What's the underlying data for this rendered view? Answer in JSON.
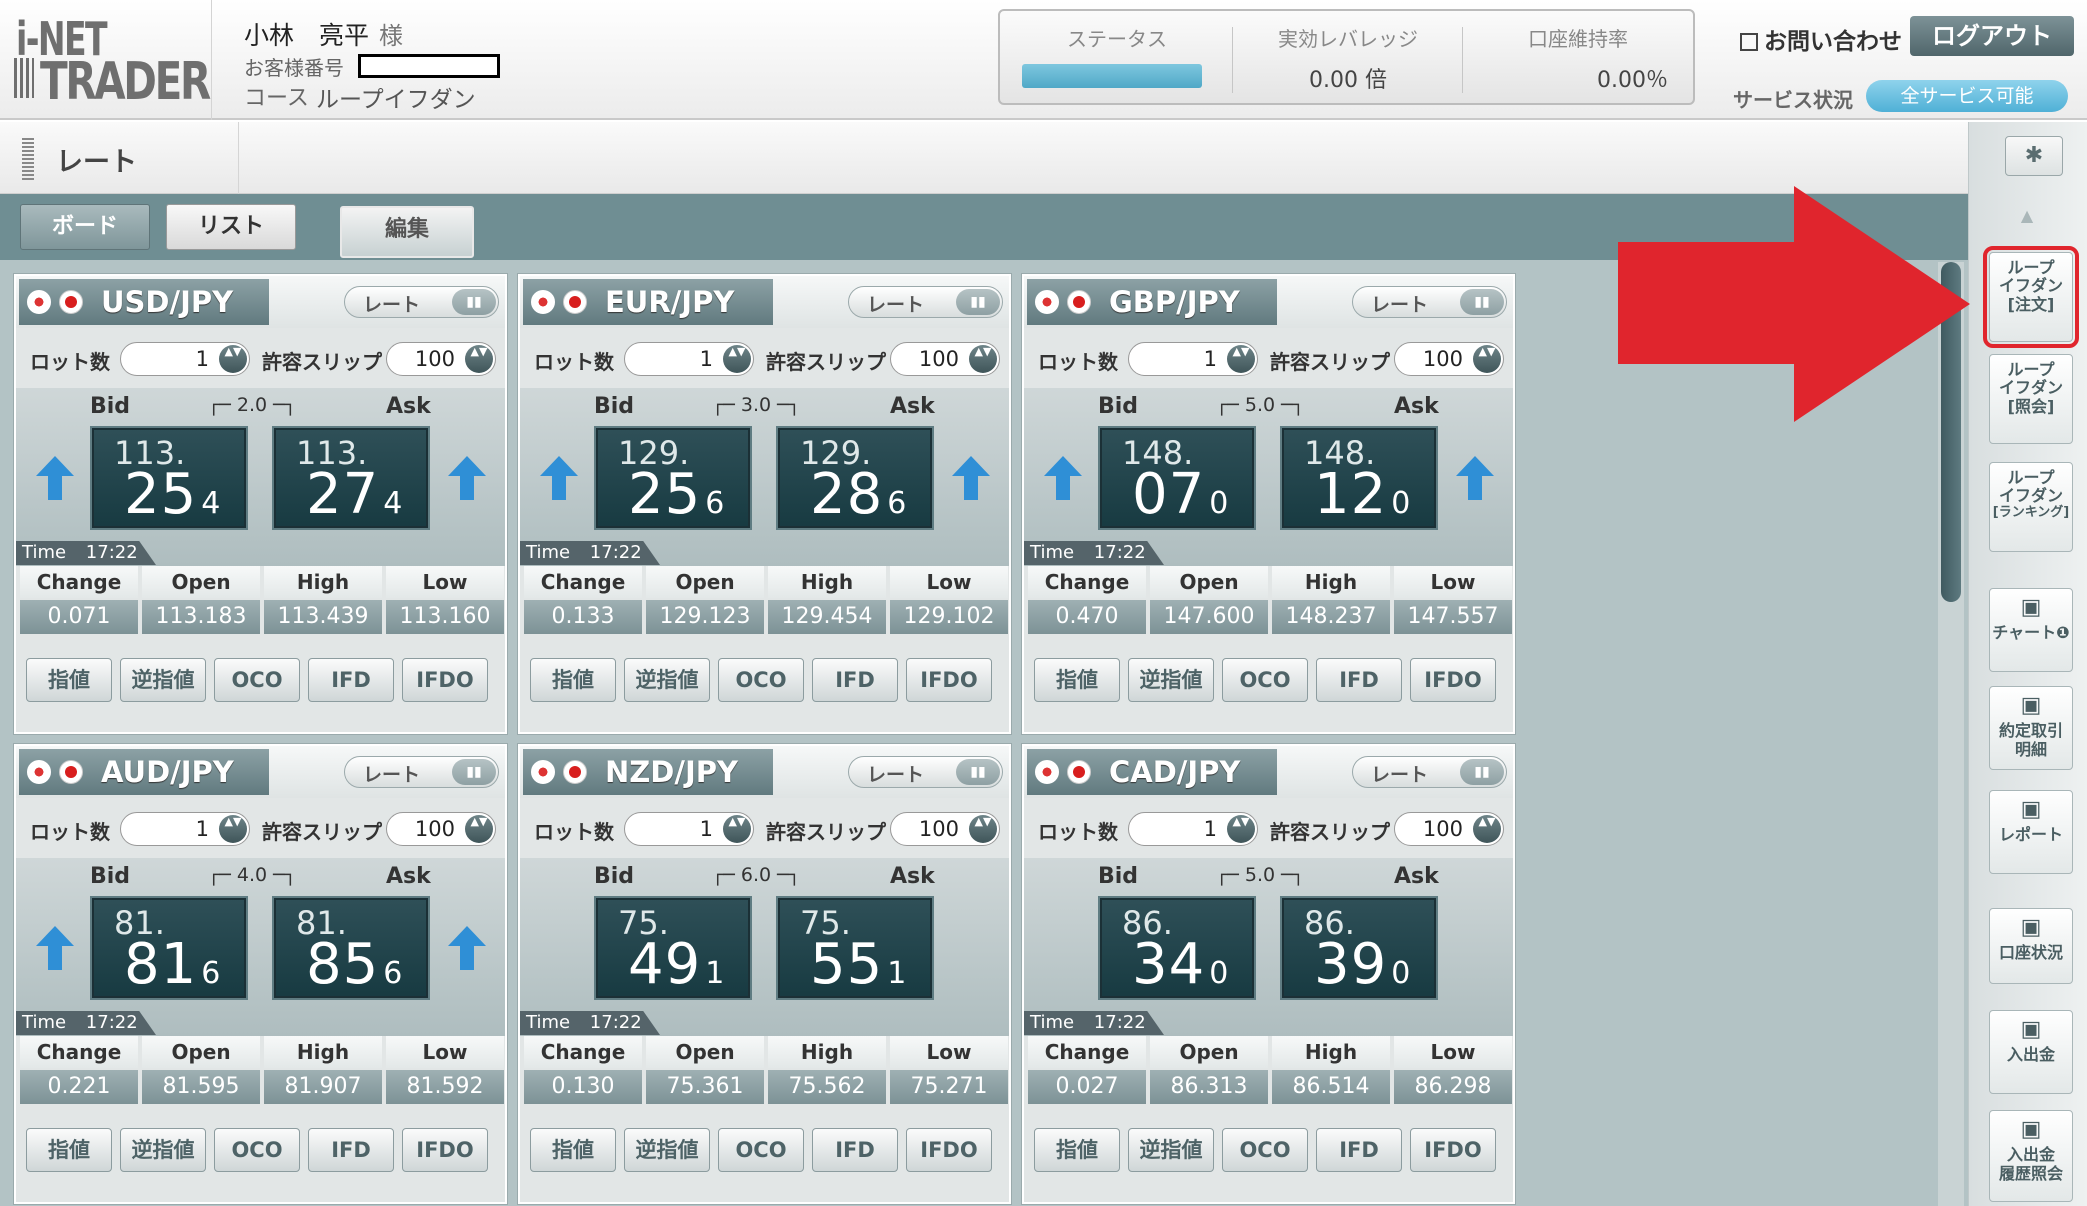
{
  "header": {
    "logo_top": "i-NET",
    "logo_bottom": "TRADER",
    "customer_name": "小林　亮平",
    "customer_suffix": "様",
    "customer_no_label": "お客様番号",
    "course_label": "コース",
    "course_value": "ループイフダン",
    "status": {
      "status_label": "ステータス",
      "leverage_label": "実効レバレッジ",
      "leverage_value": "0.00 倍",
      "margin_label": "口座維持率",
      "margin_value": "0.00％",
      "status_color": "#4fa8c7"
    },
    "contact_label": "お問い合わせ",
    "logout_label": "ログアウト",
    "service_label": "サービス状況",
    "service_value": "全サービス可能"
  },
  "titlebar": {
    "title": "レート"
  },
  "tabs": {
    "board": "ボード",
    "list": "リスト",
    "edit": "編集"
  },
  "labels": {
    "lot": "ロット数",
    "slip": "許容スリップ",
    "bid": "Bid",
    "ask": "Ask",
    "rate_toggle": "レート",
    "time": "Time",
    "change": "Change",
    "open": "Open",
    "high": "High",
    "low": "Low",
    "orders": [
      "指値",
      "逆指値",
      "OCO",
      "IFD",
      "IFDO"
    ]
  },
  "cards": [
    {
      "pair": "USD/JPY",
      "flag": "us",
      "lot": "1",
      "slip": "100",
      "spread": "2.0",
      "bid_big": "113.",
      "bid_pips": "25",
      "bid_small": "4",
      "ask_big": "113.",
      "ask_pips": "27",
      "ask_small": "4",
      "arrows": true,
      "time": "17:22",
      "change": "0.071",
      "open": "113.183",
      "high": "113.439",
      "low": "113.160"
    },
    {
      "pair": "EUR/JPY",
      "flag": "eu",
      "lot": "1",
      "slip": "100",
      "spread": "3.0",
      "bid_big": "129.",
      "bid_pips": "25",
      "bid_small": "6",
      "ask_big": "129.",
      "ask_pips": "28",
      "ask_small": "6",
      "arrows": true,
      "time": "17:22",
      "change": "0.133",
      "open": "129.123",
      "high": "129.454",
      "low": "129.102"
    },
    {
      "pair": "GBP/JPY",
      "flag": "gb",
      "lot": "1",
      "slip": "100",
      "spread": "5.0",
      "bid_big": "148.",
      "bid_pips": "07",
      "bid_small": "0",
      "ask_big": "148.",
      "ask_pips": "12",
      "ask_small": "0",
      "arrows": true,
      "time": "17:22",
      "change": "0.470",
      "open": "147.600",
      "high": "148.237",
      "low": "147.557"
    },
    {
      "pair": "AUD/JPY",
      "flag": "au",
      "lot": "1",
      "slip": "100",
      "spread": "4.0",
      "bid_big": "81.",
      "bid_pips": "81",
      "bid_small": "6",
      "ask_big": "81.",
      "ask_pips": "85",
      "ask_small": "6",
      "arrows": true,
      "time": "17:22",
      "change": "0.221",
      "open": "81.595",
      "high": "81.907",
      "low": "81.592"
    },
    {
      "pair": "NZD/JPY",
      "flag": "nz",
      "lot": "1",
      "slip": "100",
      "spread": "6.0",
      "bid_big": "75.",
      "bid_pips": "49",
      "bid_small": "1",
      "ask_big": "75.",
      "ask_pips": "55",
      "ask_small": "1",
      "arrows": false,
      "time": "17:22",
      "change": "0.130",
      "open": "75.361",
      "high": "75.562",
      "low": "75.271"
    },
    {
      "pair": "CAD/JPY",
      "flag": "ca",
      "lot": "1",
      "slip": "100",
      "spread": "5.0",
      "bid_big": "86.",
      "bid_pips": "34",
      "bid_small": "0",
      "ask_big": "86.",
      "ask_pips": "39",
      "ask_small": "0",
      "arrows": false,
      "time": "17:22",
      "change": "0.027",
      "open": "86.313",
      "high": "86.514",
      "low": "86.298"
    }
  ],
  "rail": {
    "gear": "gear-icon",
    "items": [
      {
        "lines": [
          "ループ",
          "イフダン",
          "[注文]"
        ],
        "highlight": true
      },
      {
        "lines": [
          "ループ",
          "イフダン",
          "[照会]"
        ],
        "highlight": false
      },
      {
        "lines": [
          "ループ",
          "イフダン",
          "[ランキング]"
        ],
        "highlight": false
      },
      {
        "lines": [
          "チャート❶"
        ],
        "icon": "chart-icon",
        "highlight": false
      },
      {
        "lines": [
          "約定取引",
          "明細"
        ],
        "icon": "trade-icon",
        "highlight": false
      },
      {
        "lines": [
          "レポート"
        ],
        "icon": "report-icon",
        "highlight": false
      },
      {
        "lines": [
          "口座状況"
        ],
        "icon": "account-icon",
        "highlight": false
      },
      {
        "lines": [
          "入出金"
        ],
        "icon": "money-icon",
        "highlight": false
      },
      {
        "lines": [
          "入出金",
          "履歴照会"
        ],
        "icon": "money-history-icon",
        "highlight": false
      }
    ]
  },
  "colors": {
    "accent": "#6f8e93",
    "annotation_arrow": "#e0252d",
    "price_box": "#173a41",
    "up_arrow": "#2f8fd6"
  }
}
